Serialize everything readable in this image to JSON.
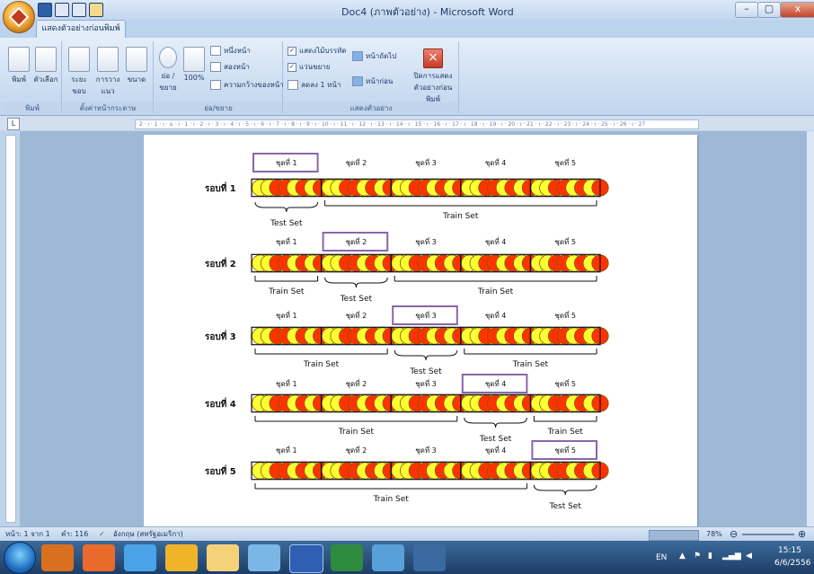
{
  "window": {
    "title": "Doc4 (ภาพตัวอย่าง) - Microsoft Word",
    "minimize": "–",
    "restore": "▢",
    "close": "x"
  },
  "ribbon": {
    "tab": "แสดงตัวอย่างก่อนพิมพ์",
    "groups": {
      "print": {
        "label": "พิมพ์",
        "print": "พิมพ์",
        "options": "ตัวเลือก"
      },
      "page_setup": {
        "label": "ตั้งค่าหน้ากระดาษ",
        "margins": "ระยะ ขอบ",
        "orientation": "การวาง แนว",
        "size": "ขนาด"
      },
      "zoom": {
        "label": "ย่อ/ขยาย",
        "zoom": "ย่อ /ขยาย",
        "percent": "100%",
        "one_page": "หนึ่งหน้า",
        "two_pages": "สองหน้า",
        "page_width": "ความกว้างของหน้า"
      },
      "preview": {
        "label": "แสดงตัวอย่าง",
        "show_ruler": "แสดงไม้บรรทัด",
        "magnifier": "แว่นขยาย",
        "shrink": "ลดลง 1 หน้า",
        "next_page": "หน้าถัดไป",
        "prev_page": "หน้าก่อน",
        "close_preview": "ปิดการแสดง ตัวอย่างก่อนพิมพ์"
      }
    }
  },
  "ruler_text": "· 2 · ı · 1 · ı · ⌂ · ı · 1 · ı · 2 · ı · 3 · ı · 4 · ı · 5 · ı · 6 · ı · 7 · ı · 8 · ı · 9 · ı · 10 · ı · 11 · ı · 12 · ı · 13 · ı · 14 · ı · 15 · ı · 16 · ı · 17 · ı · 18 · ı · 19 · ı · 20 · ı · 21 · ı · 22 · ı · 23 · ı · 24 · ı · 25 · ı · 26 · ı · 27",
  "diagram": {
    "sets": [
      "ชุดที่ 1",
      "ชุดที่ 2",
      "ชุดที่ 3",
      "ชุดที่ 4",
      "ชุดที่ 5"
    ],
    "rounds": [
      "รอบที่ 1",
      "รอบที่ 2",
      "รอบที่ 3",
      "รอบที่ 4",
      "รอบที่ 5"
    ],
    "train_label": "Train Set",
    "test_label": "Test Set",
    "segment_pattern": [
      "yellow",
      "yellow",
      "red",
      "red",
      "yellow",
      "red",
      "yellow",
      "red"
    ],
    "test_index_per_round": [
      0,
      1,
      2,
      3,
      4
    ]
  },
  "status": {
    "page": "หน้า: 1 จาก 1",
    "words": "คำ: 116",
    "language": "อังกฤษ (สหรัฐอเมริกา)",
    "zoom": "78%"
  },
  "tray": {
    "lang": "EN",
    "time": "15:15",
    "date": "6/6/2556"
  },
  "colors": {
    "yellow": "#ffff33",
    "red": "#ff3300",
    "box": "#8866aa"
  }
}
